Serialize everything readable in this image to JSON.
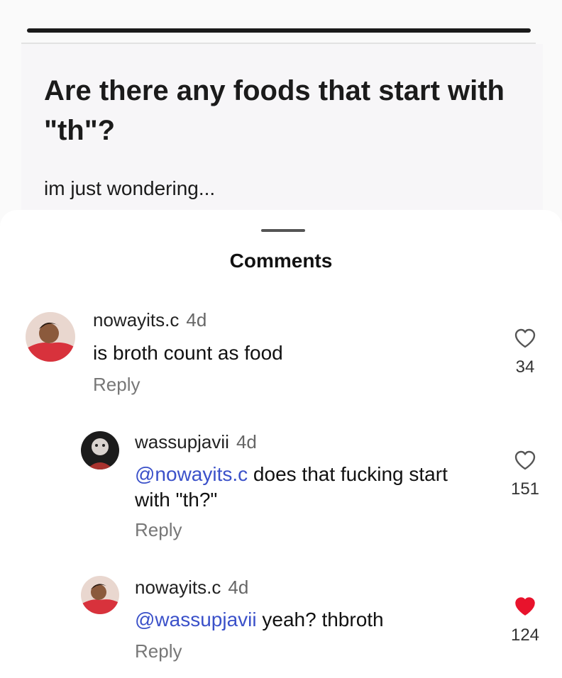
{
  "post": {
    "title": "Are there any foods that start with \"th\"?",
    "body": "im just wondering..."
  },
  "comments_header": "Comments",
  "comments": [
    {
      "username": "nowayits.c",
      "age": "4d",
      "text": "is broth count as food",
      "reply_label": "Reply",
      "likes": "34",
      "liked": false
    },
    {
      "username": "wassupjavii",
      "age": "4d",
      "mention": "@nowayits.c",
      "text": " does that fucking start with \"th?\"",
      "reply_label": "Reply",
      "likes": "151",
      "liked": false
    },
    {
      "username": "nowayits.c",
      "age": "4d",
      "mention": "@wassupjavii",
      "text": " yeah? thbroth",
      "reply_label": "Reply",
      "likes": "124",
      "liked": true
    }
  ],
  "colors": {
    "mention": "#3b51c9",
    "liked_heart": "#e8132c"
  }
}
